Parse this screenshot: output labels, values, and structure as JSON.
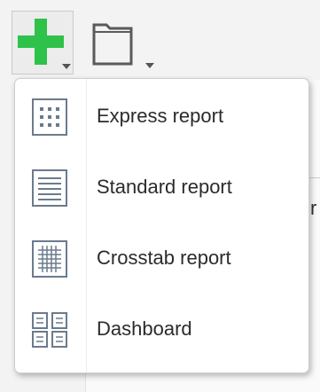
{
  "toolbar": {
    "add_button": {
      "icon": "plus-icon",
      "accent": "#2ec24a",
      "has_dropdown": true
    },
    "folder_button": {
      "icon": "folder-icon",
      "has_dropdown": true
    }
  },
  "new_menu": {
    "items": [
      {
        "label": "Express report",
        "icon": "express-report-icon"
      },
      {
        "label": "Standard report",
        "icon": "standard-report-icon"
      },
      {
        "label": "Crosstab report",
        "icon": "crosstab-report-icon"
      },
      {
        "label": "Dashboard",
        "icon": "dashboard-icon"
      }
    ]
  },
  "background": {
    "partial_text": "r"
  },
  "colors": {
    "icon_stroke": "#6b7b8c",
    "menu_bg": "#ffffff",
    "toolbar_bg": "#f3f3f3"
  }
}
